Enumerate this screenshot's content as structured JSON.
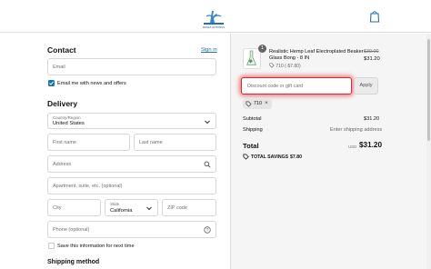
{
  "store": {
    "logo_alt": "Bongs & Beyond logo",
    "logo_text": "BONGS OF BONGS",
    "cart_icon": "shopping-bag-icon"
  },
  "contact": {
    "heading": "Contact",
    "sign_in": "Sign in",
    "email_placeholder": "Email",
    "newsletter_label": "Email me with news and offers",
    "newsletter_checked": true
  },
  "delivery": {
    "heading": "Delivery",
    "country_label": "Country/Region",
    "country_value": "United States",
    "first_name_placeholder": "First name",
    "last_name_placeholder": "Last name",
    "address_placeholder": "Address",
    "apartment_placeholder": "Apartment, suite, etc. (optional)",
    "city_placeholder": "City",
    "state_label": "State",
    "state_value": "California",
    "zip_placeholder": "ZIP code",
    "phone_placeholder": "Phone (optional)",
    "save_label": "Save this information for next time",
    "save_checked": false
  },
  "shipping_method": {
    "heading": "Shipping method"
  },
  "summary": {
    "product": {
      "quantity": "1",
      "title": "Realistic Hemp Leaf Electroplated Beaker Glass Bong - 8 IN",
      "discount_code": "710 (-$7.80)",
      "original_price": "$39.00",
      "price": "$31.20"
    },
    "discount_placeholder": "Discount code or gift card",
    "apply_label": "Apply",
    "applied_code": "710",
    "subtotal_label": "Subtotal",
    "subtotal_value": "$31.20",
    "shipping_label": "Shipping",
    "shipping_value": "Enter shipping address",
    "total_label": "Total",
    "currency": "USD",
    "total_value": "$31.20",
    "savings_label": "TOTAL SAVINGS",
    "savings_value": "$7.80"
  },
  "colors": {
    "accent": "#1773b0",
    "highlight": "#e22333",
    "summary_bg": "#f5f5f5"
  }
}
